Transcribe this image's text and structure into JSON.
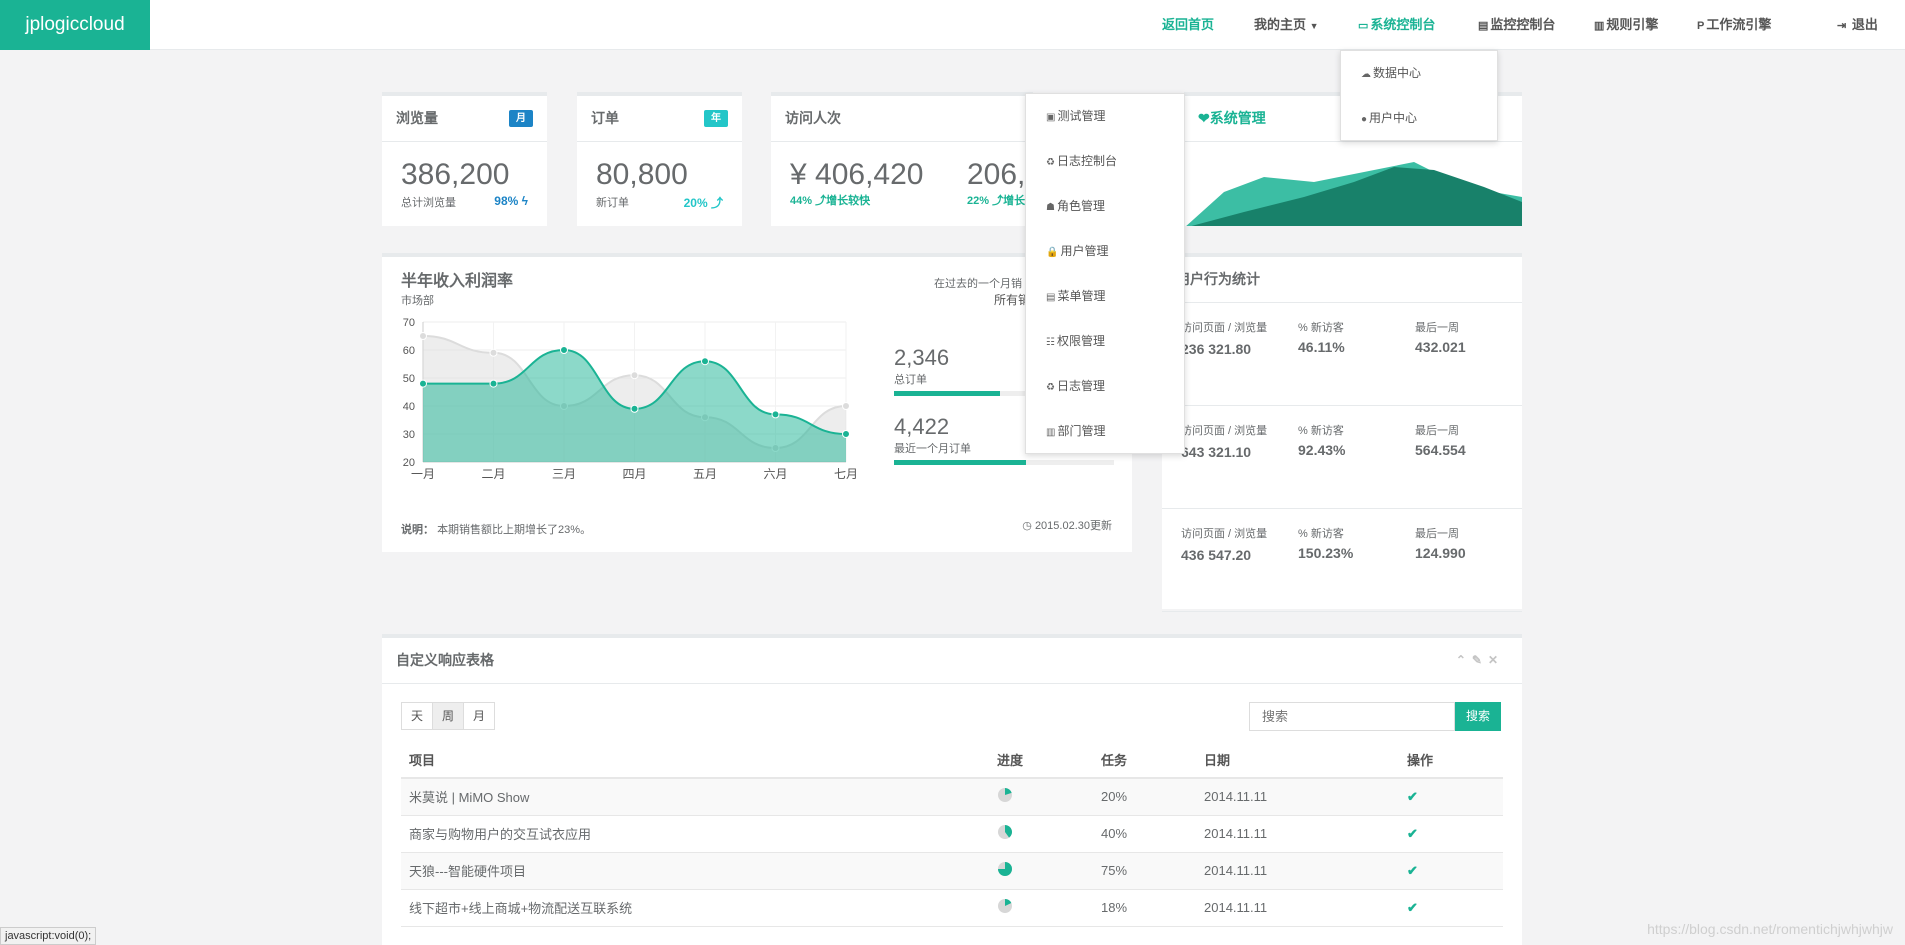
{
  "brand": "jplogiccloud",
  "nav": {
    "home": "返回首页",
    "my_home": "我的主页",
    "system_console": "系统控制台",
    "monitor_console": "监控控制台",
    "rule_engine": "规则引擎",
    "workflow_engine": "工作流引擎",
    "logout": "退出"
  },
  "system_dropdown": [
    {
      "label": "数据中心",
      "icon": "cloud-icon"
    },
    {
      "label": "用户中心",
      "icon": "user-icon"
    }
  ],
  "console_dropdown": [
    {
      "label": "测试管理",
      "icon": "test-icon"
    },
    {
      "label": "日志控制台",
      "icon": "recycle-icon"
    },
    {
      "label": "角色管理",
      "icon": "group-icon"
    },
    {
      "label": "用户管理",
      "icon": "lock-icon"
    },
    {
      "label": "菜单管理",
      "icon": "keyboard-icon"
    },
    {
      "label": "权限管理",
      "icon": "sitemap-icon"
    },
    {
      "label": "日志管理",
      "icon": "recycle-icon"
    },
    {
      "label": "部门管理",
      "icon": "bank-icon"
    }
  ],
  "cards": {
    "views": {
      "title": "浏览量",
      "badge": "月",
      "value": "386,200",
      "sub": "总计浏览量",
      "pct": "98%"
    },
    "orders": {
      "title": "订单",
      "badge": "年",
      "value": "80,800",
      "sub": "新订单",
      "pct": "20%"
    },
    "visits": {
      "title": "访问人次",
      "value1": "¥ 406,420",
      "pct1": "44%",
      "note1": "增长较快",
      "value2": "206,",
      "pct2": "22%",
      "note2": "增长"
    },
    "sysmgmt": {
      "title": "系统管理"
    }
  },
  "income": {
    "title": "半年收入利润率",
    "subtitle": "市场部",
    "right_note1": "在过去的一个月销",
    "right_note2": "所有销",
    "stat1_value": "2,346",
    "stat1_label": "总订单",
    "stat1_progress": 0.48,
    "stat2_value": "4,422",
    "stat2_label": "最近一个月订单",
    "stat2_progress": 0.6,
    "note_label": "说明：",
    "note_text": "本期销售额比上期增长了23%。",
    "updated": "2015.02.30更新"
  },
  "chart_data": {
    "type": "area",
    "categories": [
      "一月",
      "二月",
      "三月",
      "四月",
      "五月",
      "六月",
      "七月"
    ],
    "ylim": [
      20,
      70
    ],
    "yticks": [
      20,
      30,
      40,
      50,
      60,
      70
    ],
    "series": [
      {
        "values": [
          65,
          59,
          40,
          51,
          36,
          25,
          40
        ]
      },
      {
        "values": [
          48,
          48,
          60,
          39,
          56,
          37,
          30
        ]
      }
    ]
  },
  "behavior": {
    "title": "用户行为统计",
    "col_labels": [
      "访问页面 / 浏览量",
      "% 新访客",
      "最后一周"
    ],
    "rows": [
      [
        "236 321.80",
        "46.11%",
        "432.021"
      ],
      [
        "643 321.10",
        "92.43%",
        "564.554"
      ],
      [
        "436 547.20",
        "150.23%",
        "124.990"
      ]
    ]
  },
  "table_panel": {
    "title": "自定义响应表格",
    "filters": [
      "天",
      "周",
      "月"
    ],
    "search_placeholder": "搜索",
    "search_button": "搜索",
    "headers": [
      "项目",
      "进度",
      "任务",
      "日期",
      "操作"
    ],
    "rows": [
      {
        "project": "米莫说 | MiMO Show",
        "progress": 0.2,
        "task": "20%",
        "date": "2014.11.11"
      },
      {
        "project": "商家与购物用户的交互试衣应用",
        "progress": 0.4,
        "task": "40%",
        "date": "2014.11.11"
      },
      {
        "project": "天狼---智能硬件项目",
        "progress": 0.75,
        "task": "75%",
        "date": "2014.11.11"
      },
      {
        "project": "线下超市+线上商城+物流配送互联系统",
        "progress": 0.18,
        "task": "18%",
        "date": "2014.11.11"
      }
    ]
  },
  "status_bar": "javascript:void(0);",
  "watermark": "https://blog.csdn.net/romentichjwhjwhjw",
  "colors": {
    "accent": "#1ab394",
    "blue": "#1c84c6",
    "cyan": "#23c6c8"
  }
}
